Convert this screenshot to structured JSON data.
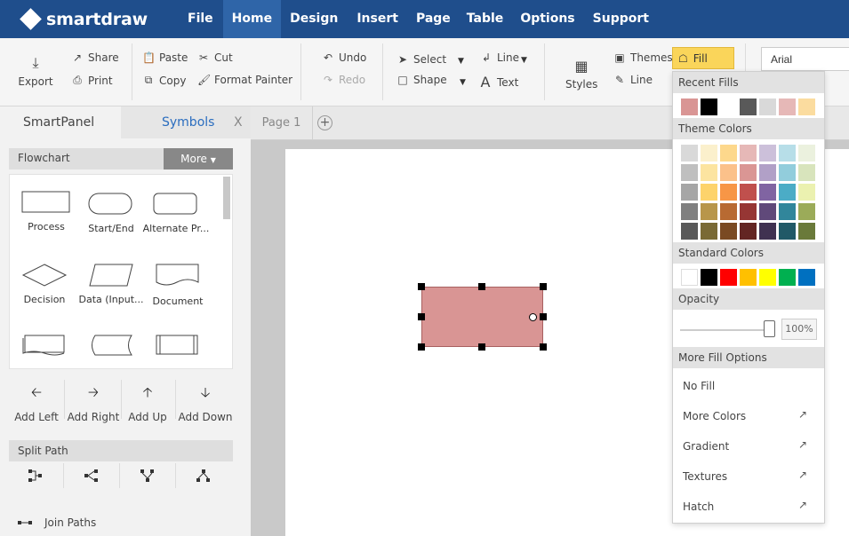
{
  "app": {
    "logo_text": "smartdraw"
  },
  "menu": [
    "File",
    "Home",
    "Design",
    "Insert",
    "Page",
    "Table",
    "Options",
    "Support"
  ],
  "ribbon": {
    "export": "Export",
    "share": "Share",
    "print": "Print",
    "paste": "Paste",
    "copy": "Copy",
    "cut": "Cut",
    "format_painter": "Format Painter",
    "undo": "Undo",
    "redo": "Redo",
    "select": "Select",
    "shape": "Shape",
    "line_tool": "Line",
    "text": "Text",
    "styles": "Styles",
    "themes": "Themes",
    "line": "Line",
    "fill": "Fill",
    "font": "Arial"
  },
  "left_panel": {
    "tab_smartpanel": "SmartPanel",
    "tab_symbols": "Symbols",
    "close": "X",
    "section_title": "Flowchart",
    "more": "More",
    "shapes": [
      "Process",
      "Start/End",
      "Alternate Pr...",
      "Decision",
      "Data (Input...",
      "Document"
    ],
    "add_left": "Add Left",
    "add_right": "Add Right",
    "add_up": "Add Up",
    "add_down": "Add Down",
    "split_path": "Split Path",
    "join_paths": "Join Paths"
  },
  "canvas": {
    "page_tab": "Page 1",
    "add_page": "+",
    "shape_fill": "#d99594"
  },
  "fill_menu": {
    "recent_fills": "Recent Fills",
    "recent_colors": [
      "#d99594",
      "#000000",
      "#ffffff",
      "#595959",
      "#d9d9d9",
      "#e6b8b7",
      "#fbdc9f"
    ],
    "theme_colors": "Theme Colors",
    "theme_grid": [
      [
        "#d9d9d9",
        "#fbf0cc",
        "#fdd88c",
        "#e6b8b7",
        "#ccc0da",
        "#b7dee8",
        "#ebf1de"
      ],
      [
        "#bfbfbf",
        "#fce4a0",
        "#fbc18a",
        "#da9694",
        "#b1a0c7",
        "#92cddc",
        "#d8e4bc"
      ],
      [
        "#a6a6a6",
        "#fdd36b",
        "#f79646",
        "#c0504d",
        "#8064a2",
        "#4bacc6",
        "#ebf1b0"
      ],
      [
        "#808080",
        "#b8964a",
        "#b86a32",
        "#963634",
        "#60497a",
        "#31869b",
        "#9bab59"
      ],
      [
        "#595959",
        "#7a6a35",
        "#7a4a22",
        "#632523",
        "#403151",
        "#215967",
        "#6a7a3a"
      ]
    ],
    "standard_colors": "Standard Colors",
    "standard_grid": [
      "#ffffff",
      "#000000",
      "#ff0000",
      "#ffc000",
      "#ffff00",
      "#00b050",
      "#0070c0"
    ],
    "opacity": "Opacity",
    "opacity_value": "100%",
    "more_fill_options": "More Fill Options",
    "no_fill": "No Fill",
    "more_colors": "More Colors",
    "gradient": "Gradient",
    "textures": "Textures",
    "hatch": "Hatch"
  }
}
